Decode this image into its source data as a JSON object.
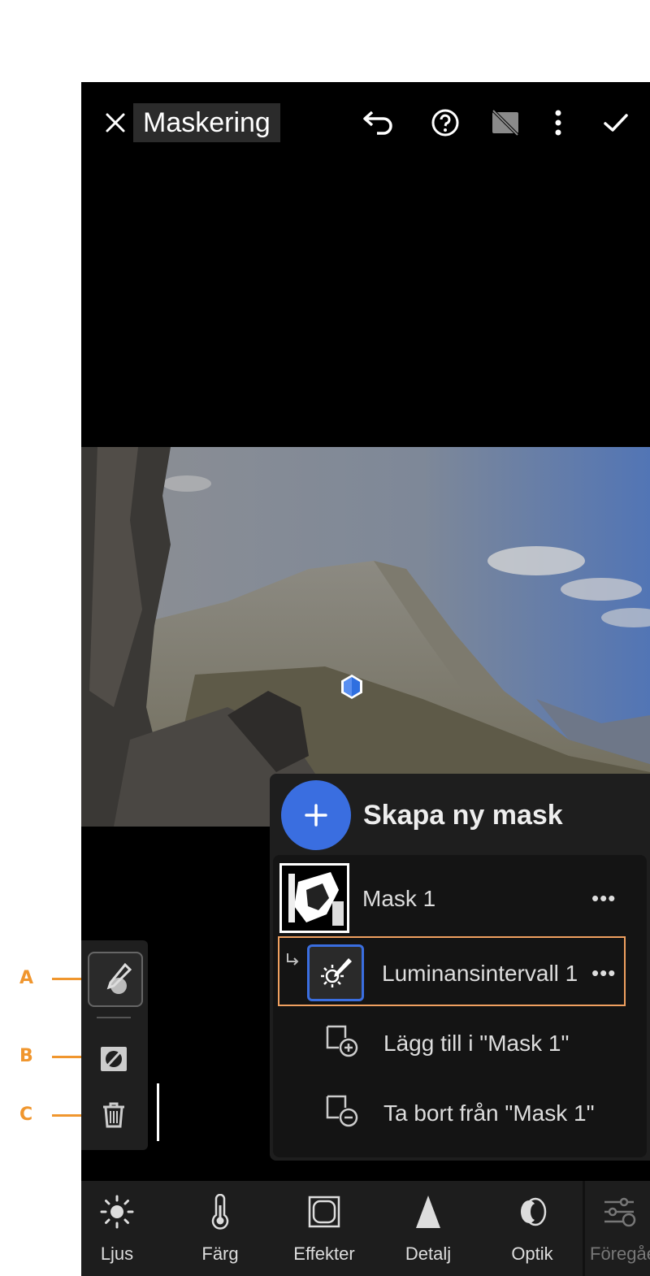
{
  "callouts": {
    "a": "A",
    "b": "B",
    "c": "C"
  },
  "topbar": {
    "title": "Maskering"
  },
  "panel": {
    "create_label": "Skapa ny mask",
    "mask_name": "Mask 1",
    "component_name": "Luminansintervall 1",
    "add_to": "Lägg till i \"Mask 1\"",
    "remove_from": "Ta bort från \"Mask 1\"",
    "more": "•••"
  },
  "bottombar": {
    "tabs": [
      {
        "label": "Ljus",
        "icon": "sun-icon"
      },
      {
        "label": "Färg",
        "icon": "thermometer-icon"
      },
      {
        "label": "Effekter",
        "icon": "vignette-icon"
      },
      {
        "label": "Detalj",
        "icon": "triangle-icon"
      },
      {
        "label": "Optik",
        "icon": "lens-icon"
      },
      {
        "label": "Föregåe",
        "icon": "presets-icon"
      }
    ]
  },
  "colors": {
    "accent": "#3a6ee0",
    "callout": "#f0962e",
    "selection": "#f0a060"
  }
}
